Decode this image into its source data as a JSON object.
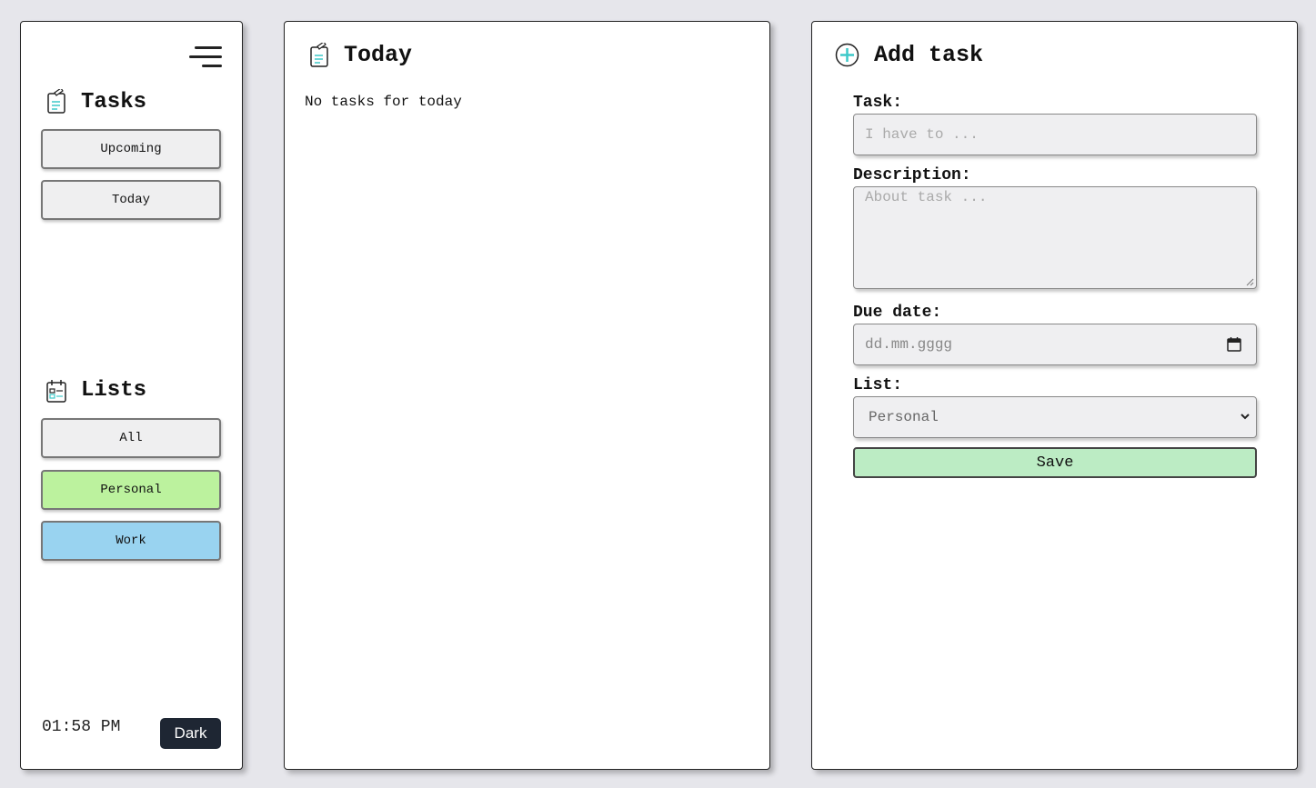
{
  "sidebar": {
    "tasks_heading": "Tasks",
    "task_nav": [
      {
        "label": "Upcoming"
      },
      {
        "label": "Today"
      }
    ],
    "lists_heading": "Lists",
    "list_nav": [
      {
        "label": "All",
        "color": "#efeff0"
      },
      {
        "label": "Personal",
        "color": "#bcf29e"
      },
      {
        "label": "Work",
        "color": "#99d3f0"
      }
    ],
    "clock": "01:58 PM",
    "theme_button": "Dark"
  },
  "center": {
    "title": "Today",
    "empty_message": "No tasks for today"
  },
  "add_task": {
    "title": "Add task",
    "task_label": "Task:",
    "task_placeholder": "I have to ...",
    "description_label": "Description:",
    "description_placeholder": "About task ...",
    "due_date_label": "Due date:",
    "due_date_placeholder": "dd.mm.gggg",
    "list_label": "List:",
    "list_selected": "Personal",
    "save_label": "Save"
  },
  "colors": {
    "background": "#e6e6eb",
    "save_button": "#bcecc4",
    "dark_button": "#1e2633",
    "icon_accent": "#3cc9c9"
  }
}
